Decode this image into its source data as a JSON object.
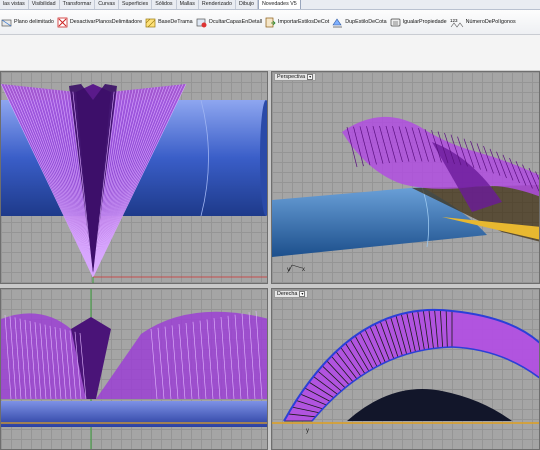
{
  "tabs": [
    {
      "label": "las vistas"
    },
    {
      "label": "Visibilidad"
    },
    {
      "label": "Transformar"
    },
    {
      "label": "Curvas"
    },
    {
      "label": "Superficies"
    },
    {
      "label": "Sólidos"
    },
    {
      "label": "Mallas"
    },
    {
      "label": "Renderizado"
    },
    {
      "label": "Dibujo"
    },
    {
      "label": "Novedades V5",
      "active": true
    }
  ],
  "toolbar": {
    "commands": [
      {
        "label": "Plano delimitado",
        "icon": "bounded-plane-icon"
      },
      {
        "label": "DesactivarPlanosDelimitadore",
        "icon": "disable-clipping-plane-icon"
      },
      {
        "label": "BaseDeTrama",
        "icon": "hatch-base-icon"
      },
      {
        "label": "OcultarCapasEnDetall",
        "icon": "hide-layers-in-detail-icon"
      },
      {
        "label": "ImportarEstilosDeCot",
        "icon": "import-dimension-styles-icon"
      },
      {
        "label": "DupEstiloDeCota",
        "icon": "duplicate-dimension-style-icon"
      },
      {
        "label": "IgualarPropiedade",
        "icon": "match-properties-icon"
      },
      {
        "label": "NúmeroDePolígonos",
        "icon": "polygon-count-icon"
      }
    ]
  },
  "viewports": {
    "top_left": {
      "title": ""
    },
    "top_right": {
      "title": "Perspectiva"
    },
    "bottom_left": {
      "title": ""
    },
    "bottom_right": {
      "title": "Derecha"
    }
  },
  "axis_labels": {
    "x": "x",
    "y": "y"
  },
  "colors": {
    "structure": "#b03ad8",
    "structure_dark": "#6a1a9a",
    "tube": "#4a6fd0",
    "grid": "#a5a5a5",
    "ground_line": "#e0a020"
  }
}
